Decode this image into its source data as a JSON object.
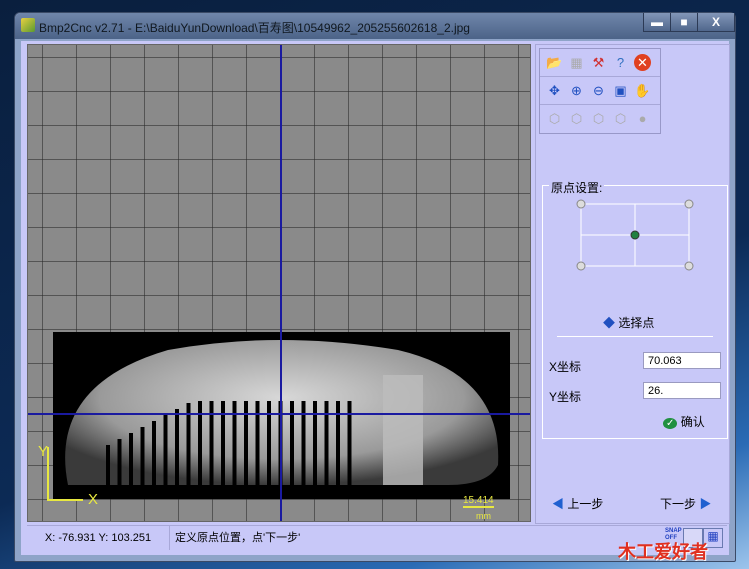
{
  "window": {
    "title": "Bmp2Cnc v2.71 - E:\\BaiduYunDownload\\百寿图\\10549962_205255602618_2.jpg",
    "minimize": "▬",
    "maximize": "■",
    "close": "X"
  },
  "toolbar": {
    "rows": [
      [
        "open-icon",
        "save-icon",
        "tool-icon",
        "help-icon",
        "exit-icon"
      ],
      [
        "origin-icon",
        "zoom-in-icon",
        "zoom-out-icon",
        "zoom-fit-icon",
        "pan-hand-icon"
      ],
      [
        "view-3d-1-icon",
        "view-3d-2-icon",
        "view-3d-3-icon",
        "view-3d-4-icon",
        "render-icon"
      ]
    ]
  },
  "canvas": {
    "axis_x": "X",
    "axis_y": "Y",
    "scale_value": "15.414",
    "scale_unit": "mm"
  },
  "origin": {
    "label": "原点设置:",
    "select_point": "选择点",
    "x_label": "X坐标",
    "x_value": "70.063",
    "y_label": "Y坐标",
    "y_value": "26.",
    "confirm": "确认"
  },
  "nav": {
    "prev": "上一步",
    "next": "下一步"
  },
  "status": {
    "coords": "X: -76.931 Y: 103.251",
    "message": "定义原点位置，点'下一步'",
    "snap": "SNAP OFF"
  },
  "watermark": "木工爱好者"
}
